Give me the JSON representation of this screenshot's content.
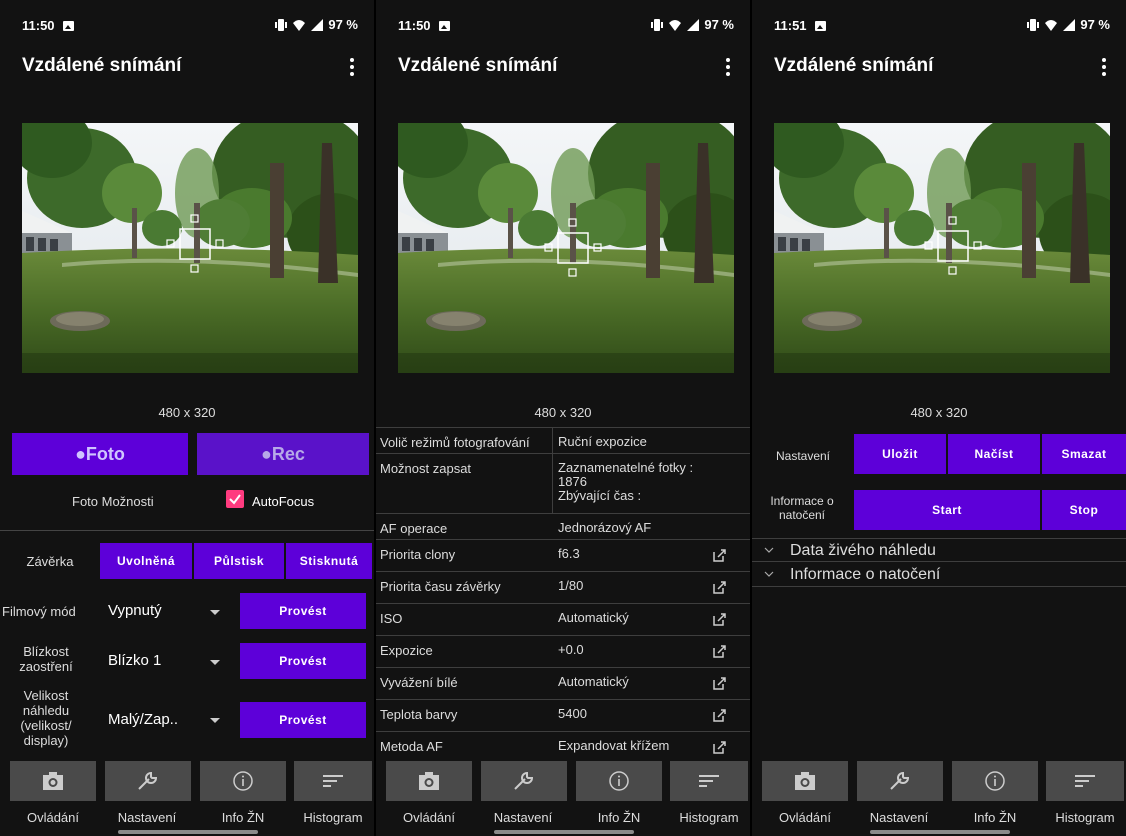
{
  "status": {
    "time1": "11:50",
    "time2": "11:50",
    "time3": "11:51",
    "battery": "97 %"
  },
  "app": {
    "title": "Vzdálené snímání"
  },
  "preview": {
    "resolution": "480 x 320"
  },
  "s1": {
    "foto_label": "●Foto",
    "rec_label": "●Rec",
    "foto_options_label": "Foto Možnosti",
    "autofocus_label": "AutoFocus",
    "shutter_label": "Závěrka",
    "shutter_buttons": [
      "Uvolněná",
      "Půlstisk",
      "Stisknutá"
    ],
    "movie_mode_label": "Filmový mód",
    "movie_mode_value": "Vypnutý",
    "focus_label": "Blízkost zaostření",
    "focus_value": "Blízko 1",
    "size_label": "Velikost náhledu (velikost/ display)",
    "size_value": "Malý/Zap..",
    "run_label": "Provést"
  },
  "s2": {
    "rows": [
      {
        "key": "Volič režimů fotografování",
        "value": "Ruční expozice"
      },
      {
        "key": "Možnost zapsat",
        "value": "Zaznamenatelné fotky : 1876 Zbývající čas :"
      },
      {
        "key": "AF operace",
        "value": "Jednorázový AF"
      },
      {
        "key": "Priorita clony",
        "value": "f6.3"
      },
      {
        "key": "Priorita času závěrky",
        "value": "1/80"
      },
      {
        "key": "ISO",
        "value": "Automatický"
      },
      {
        "key": "Expozice",
        "value": "+0.0"
      },
      {
        "key": "Vyvážení bílé",
        "value": "Automatický"
      },
      {
        "key": "Teplota barvy",
        "value": "5400"
      },
      {
        "key": "Metoda AF",
        "value": "Expandovat křížem"
      }
    ],
    "write_line1": "Zaznamenatelné fotky :",
    "write_line2": "1876",
    "write_line3": "Zbývající čas :"
  },
  "s3": {
    "settings_label": "Nastavení",
    "save_label": "Uložit",
    "load_label": "Načíst",
    "delete_label": "Smazat",
    "rec_info_label": "Informace o natočení",
    "start_label": "Start",
    "stop_label": "Stop",
    "expander1": "Data živého náhledu",
    "expander2": "Informace o natočení"
  },
  "nav": {
    "items": [
      "Ovládání",
      "Nastavení",
      "Info ŽN",
      "Histogram"
    ],
    "icons": [
      "camera-icon",
      "wrench-icon",
      "info-icon",
      "histogram-icon"
    ]
  },
  "colors": {
    "accent": "#5d00d9",
    "checkbox": "#ff3b7f",
    "background": "#121212",
    "nav_button": "#4a4a4a"
  }
}
